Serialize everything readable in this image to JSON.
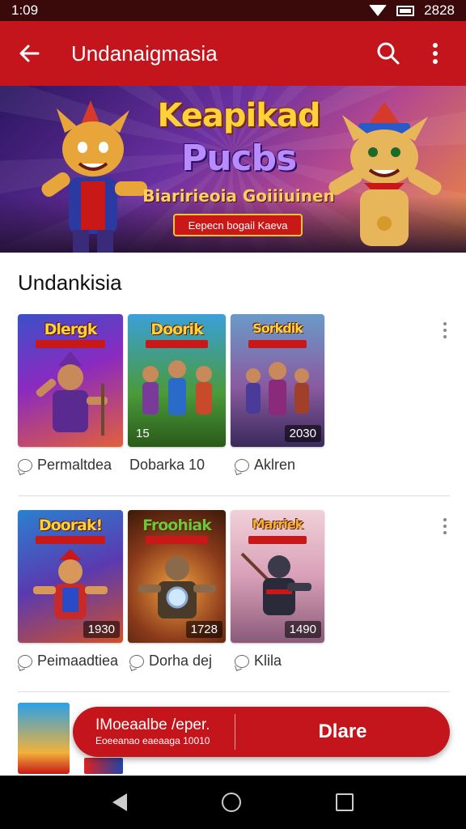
{
  "status_bar": {
    "time": "1:09",
    "clock_right": "2828"
  },
  "app_bar": {
    "title": "Undanaigmasia",
    "back_icon": "arrow-left-icon",
    "search_icon": "search-icon",
    "menu_icon": "more-vert-icon"
  },
  "banner": {
    "line1": "Keapikad",
    "line2": "Pucbs",
    "line3": "Biaririeoia Goiiiuinen",
    "pill": "Eepecn bogail Kaeva"
  },
  "section": {
    "title": "Undankisia"
  },
  "rows": [
    {
      "thumbs": [
        {
          "title": "Dlergk",
          "count": ""
        },
        {
          "title": "Doorik",
          "count": "15"
        },
        {
          "title": "Sorkdik",
          "count": "2030"
        }
      ],
      "meta": [
        "Permaltdea",
        "Dobarka 10",
        "Aklren"
      ]
    },
    {
      "thumbs": [
        {
          "title": "Doorak!",
          "count": "1930"
        },
        {
          "title": "Froohiak",
          "count": "1728"
        },
        {
          "title": "Marriek",
          "count": "1490"
        }
      ],
      "meta": [
        "Peimaadtiea",
        "Dorha dej",
        "Klila"
      ]
    }
  ],
  "float_bar": {
    "line1": "IMoeaalbe /eper.",
    "line2": "Eoeeanao eaeaaga 10010",
    "action": "Dlare"
  },
  "colors": {
    "primary": "#c4141c",
    "status": "#3a0a0a",
    "nav": "#000000"
  }
}
